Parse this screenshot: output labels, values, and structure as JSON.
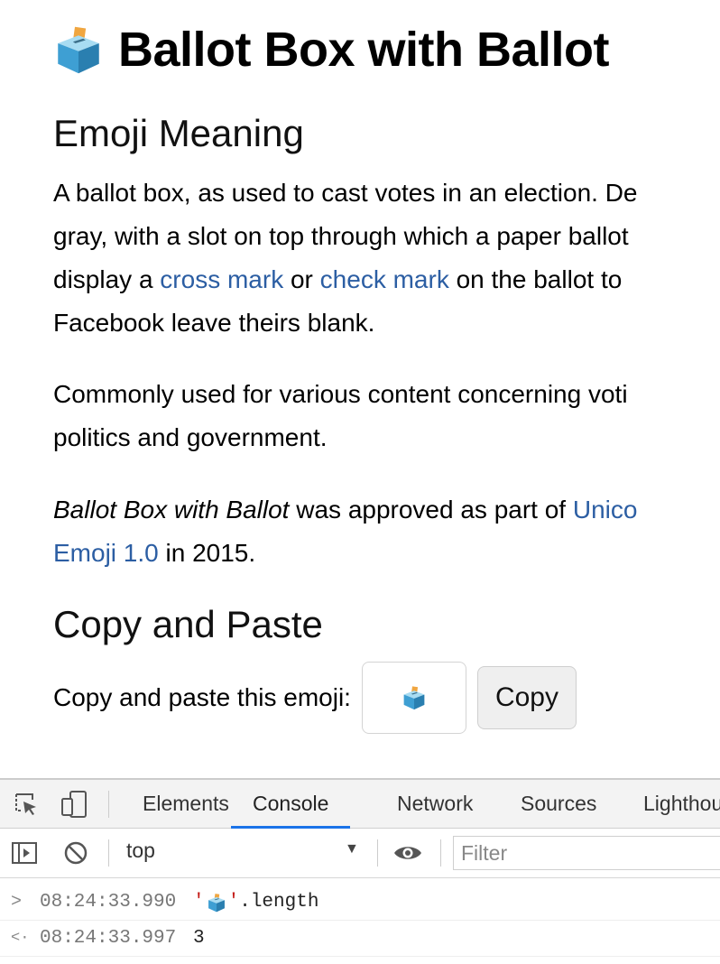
{
  "page": {
    "title": "Ballot Box with Ballot",
    "sections": {
      "meaning_heading": "Emoji Meaning",
      "copy_heading": "Copy and Paste"
    },
    "para1": {
      "line1": "A ballot box, as used to cast votes in an election. De",
      "line2": "gray, with a slot on top through which a paper ballot",
      "line3_a": "display a ",
      "line3_link1": "cross mark",
      "line3_b": " or ",
      "line3_link2": "check mark",
      "line3_c": " on the ballot to",
      "line4": "Facebook leave theirs blank."
    },
    "para2": {
      "line1": "Commonly used for various content concerning voti",
      "line2": "politics and government."
    },
    "para3": {
      "italic": "Ballot Box with Ballot",
      "line1_b": " was approved as part of ",
      "line1_link": "Unico",
      "line2_link": "Emoji 1.0",
      "line2_b": " in 2015."
    },
    "copy": {
      "label": "Copy and paste this emoji:",
      "button": "Copy"
    }
  },
  "devtools": {
    "tabs": [
      "Elements",
      "Console",
      "Network",
      "Sources",
      "Lighthou"
    ],
    "active_tab": "Console",
    "context": "top",
    "filter_placeholder": "Filter",
    "console": [
      {
        "prompt": ">",
        "timestamp": "08:24:33.990",
        "quote_open": "'",
        "quote_close": "'",
        "suffix": ".length"
      },
      {
        "prompt": "<·",
        "timestamp": "08:24:33.997",
        "result": "3"
      }
    ]
  },
  "colors": {
    "link": "#2c5ea3",
    "active_tab_underline": "#1a73e8",
    "console_string": "#c41a16",
    "console_number": "#1c00cf"
  },
  "icons": [
    "ballot-box-emoji",
    "inspect-icon",
    "device-toggle-icon",
    "sidebar-toggle-icon",
    "clear-console-icon",
    "eye-icon",
    "dropdown-arrow-icon"
  ]
}
